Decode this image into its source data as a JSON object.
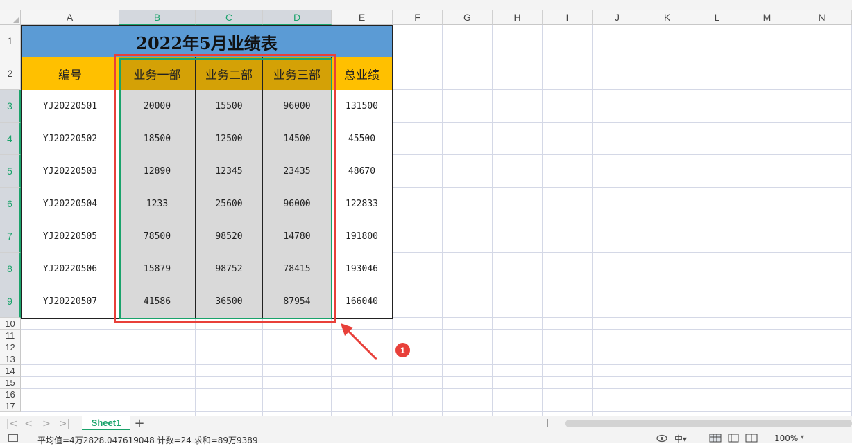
{
  "spreadsheet": {
    "columns": [
      "A",
      "B",
      "C",
      "D",
      "E",
      "F",
      "G",
      "H",
      "I",
      "J",
      "K",
      "L",
      "M",
      "N"
    ],
    "rows": [
      "1",
      "2",
      "3",
      "4",
      "5",
      "6",
      "7",
      "8",
      "9",
      "10",
      "11",
      "12",
      "13",
      "14",
      "15",
      "16",
      "17"
    ],
    "title": "2022年5月业绩表",
    "headers": [
      "编号",
      "业务一部",
      "业务二部",
      "业务三部",
      "总业绩"
    ],
    "records": [
      [
        "YJ20220501",
        "20000",
        "15500",
        "96000",
        "131500"
      ],
      [
        "YJ20220502",
        "18500",
        "12500",
        "14500",
        "45500"
      ],
      [
        "YJ20220503",
        "12890",
        "12345",
        "23435",
        "48670"
      ],
      [
        "YJ20220504",
        "1233",
        "25600",
        "96000",
        "122833"
      ],
      [
        "YJ20220505",
        "78500",
        "98520",
        "14780",
        "191800"
      ],
      [
        "YJ20220506",
        "15879",
        "98752",
        "78415",
        "193046"
      ],
      [
        "YJ20220507",
        "41586",
        "36500",
        "87954",
        "166040"
      ]
    ]
  },
  "annotation": {
    "badge": "1",
    "color": "#e8403a"
  },
  "sheet_tabs": {
    "active": "Sheet1",
    "add": "+"
  },
  "nav": {
    "first": "|<",
    "prev": "<",
    "next": ">",
    "last": ">|"
  },
  "status": {
    "summary": "平均值=4万2828.047619048   计数=24   求和=89万9389",
    "zoom": "100%"
  },
  "colors": {
    "selection": "#1aa36b",
    "title_fill": "#5b9bd5",
    "header_fill": "#ffc000"
  }
}
